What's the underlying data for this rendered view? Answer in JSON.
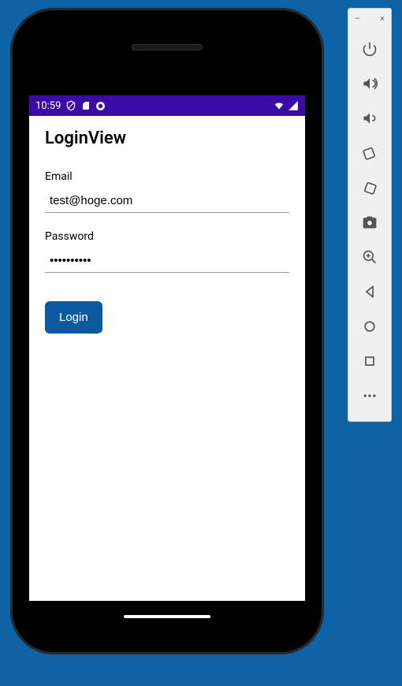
{
  "status_bar": {
    "time": "10:59"
  },
  "page": {
    "title": "LoginView"
  },
  "form": {
    "email_label": "Email",
    "email_value": "test@hoge.com",
    "password_label": "Password",
    "password_value": "••••••••••",
    "login_button": "Login"
  },
  "toolbar": {
    "minimize": "–",
    "close": "×"
  }
}
